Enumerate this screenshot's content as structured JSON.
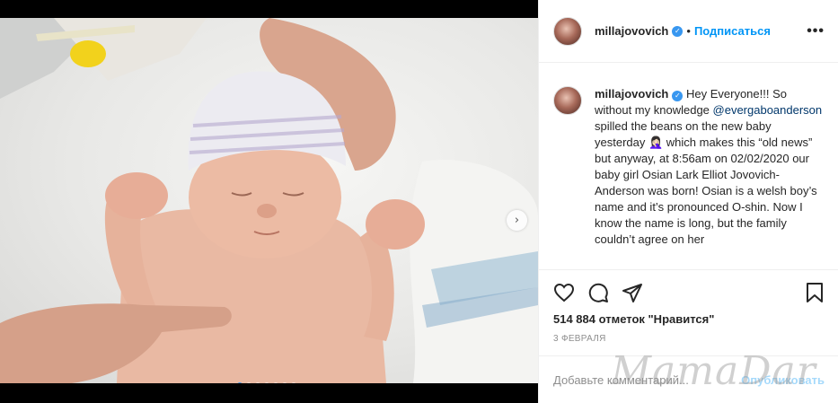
{
  "post": {
    "username": "millajovovich",
    "follow_label": "Подписаться",
    "more_label": "•••",
    "separator": "•",
    "caption_username": "millajovovich",
    "caption_part1": " Hey Everyone!!! So without my knowledge ",
    "caption_mention": "@evergaboanderson",
    "caption_part2": " spilled the beans on the new baby yesterday 🤦🏻‍♀️ which makes this “old news” but anyway, at 8:56am on 02/02/2020 our baby girl Osian Lark Elliot Jovovich-Anderson was born! Osian is a welsh boy’s name and it’s pronounced O-shin. Now I know the name is long, but the family couldn’t agree on her",
    "likes": "514 884 отметок \"Нравится\"",
    "date": "3 ФЕВРАЛЯ",
    "comment_placeholder": "Добавьте комментарий...",
    "publish_label": "Опубликовать"
  },
  "carousel": {
    "count": 7,
    "active": 0,
    "next_glyph": "›"
  },
  "watermark": "MamaDar",
  "colors": {
    "accent": "#0095f6",
    "verified": "#3897f0",
    "text": "#262626",
    "muted": "#8e8e8e"
  },
  "icons": [
    "heart-icon",
    "comment-icon",
    "share-icon",
    "bookmark-icon",
    "verified-icon",
    "more-icon"
  ]
}
